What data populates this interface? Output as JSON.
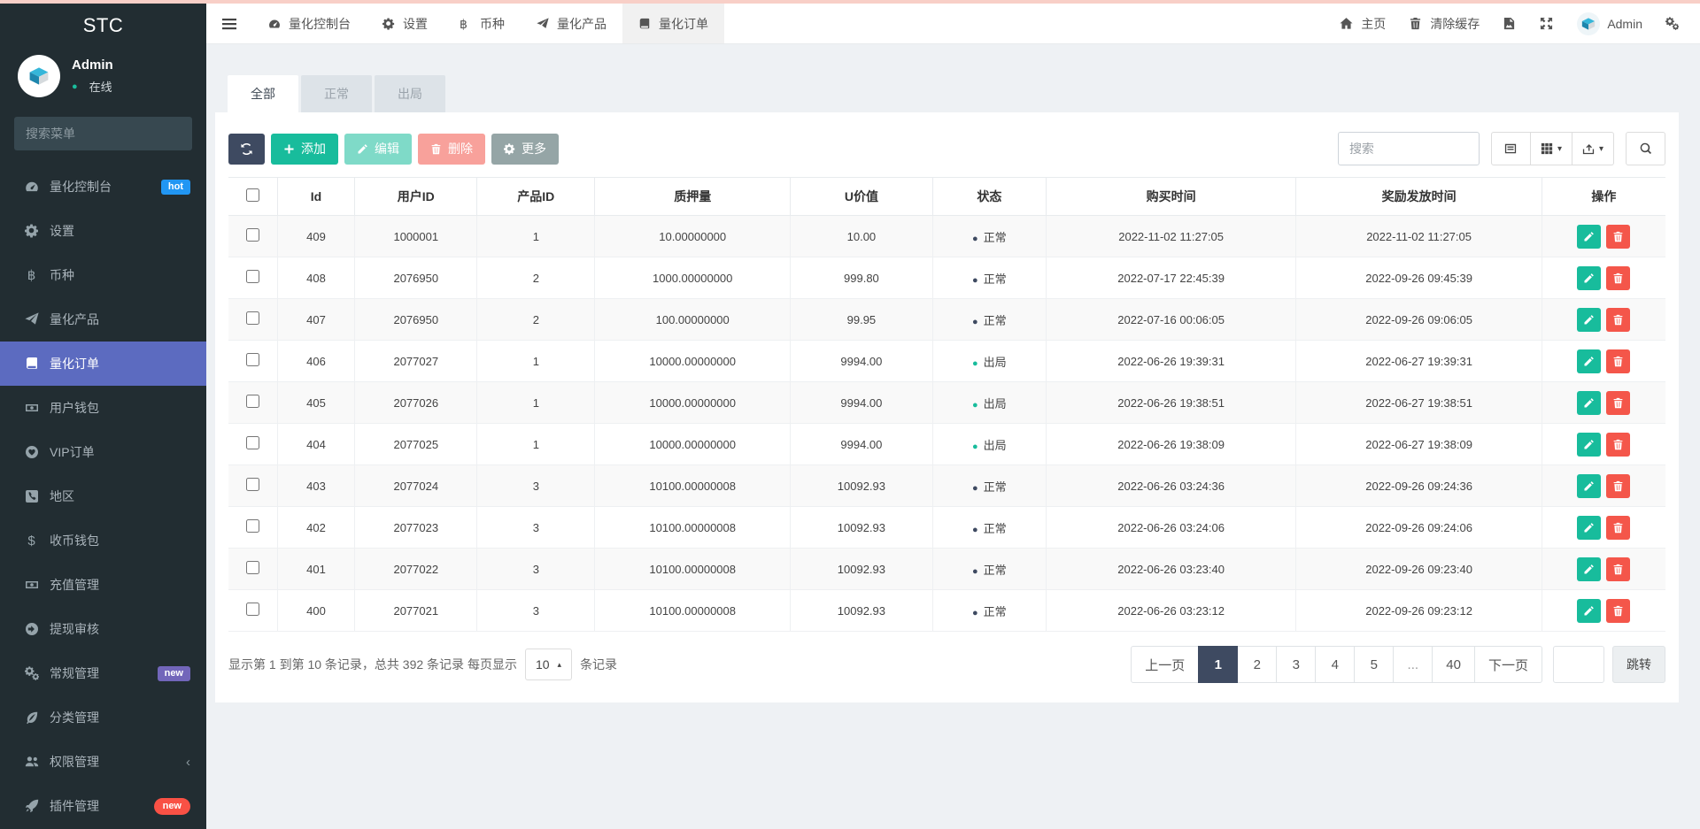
{
  "app": {
    "brand": "STC"
  },
  "colors": {
    "topstrip": "#f8cfc7",
    "sidebar_bg": "#222d32",
    "sidebar_active": "#5c6bc0",
    "success": "#18bc9c",
    "danger": "#f4564a",
    "dark": "#3e4a61",
    "hot_badge": "#2196f3",
    "new_badge_purple": "#7266ba",
    "new_badge_red": "#f95145"
  },
  "sidebar": {
    "user": {
      "name": "Admin",
      "status": "在线"
    },
    "search_placeholder": "搜索菜单",
    "items": [
      {
        "key": "dashboard",
        "label": "量化控制台",
        "icon": "gauge-icon",
        "badge": "hot",
        "badge_color": "#2196f3"
      },
      {
        "key": "settings",
        "label": "设置",
        "icon": "gear-icon"
      },
      {
        "key": "currency",
        "label": "币种",
        "icon": "bitcoin-icon"
      },
      {
        "key": "product",
        "label": "量化产品",
        "icon": "send-icon"
      },
      {
        "key": "order",
        "label": "量化订单",
        "icon": "book-icon",
        "active": true
      },
      {
        "key": "user-wallet",
        "label": "用户钱包",
        "icon": "money-icon"
      },
      {
        "key": "vip-order",
        "label": "VIP订单",
        "icon": "heart-icon"
      },
      {
        "key": "region",
        "label": "地区",
        "icon": "phone-icon"
      },
      {
        "key": "coin-wallet",
        "label": "收币钱包",
        "icon": "dollar-icon"
      },
      {
        "key": "recharge",
        "label": "充值管理",
        "icon": "money-icon"
      },
      {
        "key": "withdraw",
        "label": "提现审核",
        "icon": "arrow-circle-icon"
      },
      {
        "key": "general",
        "label": "常规管理",
        "icon": "cogs-icon",
        "badge": "new",
        "badge_color": "#7266ba"
      },
      {
        "key": "category",
        "label": "分类管理",
        "icon": "leaf-icon"
      },
      {
        "key": "auth",
        "label": "权限管理",
        "icon": "users-icon",
        "chevron": "‹"
      },
      {
        "key": "addon",
        "label": "插件管理",
        "icon": "rocket-icon",
        "badge": "new",
        "badge_color": "#f95145",
        "badge_pill": true
      }
    ]
  },
  "topbar": {
    "tabs": [
      {
        "key": "dashboard",
        "label": "量化控制台",
        "icon": "gauge-icon"
      },
      {
        "key": "settings",
        "label": "设置",
        "icon": "gear-icon"
      },
      {
        "key": "currency",
        "label": "币种",
        "icon": "bitcoin-icon"
      },
      {
        "key": "product",
        "label": "量化产品",
        "icon": "send-icon"
      },
      {
        "key": "order",
        "label": "量化订单",
        "icon": "book-icon",
        "active": true
      }
    ],
    "right": {
      "home": "主页",
      "clear_cache": "清除缓存",
      "username": "Admin"
    }
  },
  "content": {
    "tabs": [
      {
        "label": "全部",
        "active": true
      },
      {
        "label": "正常"
      },
      {
        "label": "出局"
      }
    ],
    "toolbar": {
      "add": "添加",
      "edit": "编辑",
      "delete": "删除",
      "more": "更多",
      "search_placeholder": "搜索"
    },
    "table": {
      "columns": [
        "Id",
        "用户ID",
        "产品ID",
        "质押量",
        "U价值",
        "状态",
        "购买时间",
        "奖励发放时间",
        "操作"
      ],
      "rows": [
        {
          "id": "409",
          "user_id": "1000001",
          "product_id": "1",
          "pledge": "10.00000000",
          "u_value": "10.00",
          "status": "正常",
          "status_type": "normal",
          "buy_time": "2022-11-02 11:27:05",
          "reward_time": "2022-11-02 11:27:05"
        },
        {
          "id": "408",
          "user_id": "2076950",
          "product_id": "2",
          "pledge": "1000.00000000",
          "u_value": "999.80",
          "status": "正常",
          "status_type": "normal",
          "buy_time": "2022-07-17 22:45:39",
          "reward_time": "2022-09-26 09:45:39"
        },
        {
          "id": "407",
          "user_id": "2076950",
          "product_id": "2",
          "pledge": "100.00000000",
          "u_value": "99.95",
          "status": "正常",
          "status_type": "normal",
          "buy_time": "2022-07-16 00:06:05",
          "reward_time": "2022-09-26 09:06:05"
        },
        {
          "id": "406",
          "user_id": "2077027",
          "product_id": "1",
          "pledge": "10000.00000000",
          "u_value": "9994.00",
          "status": "出局",
          "status_type": "out",
          "buy_time": "2022-06-26 19:39:31",
          "reward_time": "2022-06-27 19:39:31"
        },
        {
          "id": "405",
          "user_id": "2077026",
          "product_id": "1",
          "pledge": "10000.00000000",
          "u_value": "9994.00",
          "status": "出局",
          "status_type": "out",
          "buy_time": "2022-06-26 19:38:51",
          "reward_time": "2022-06-27 19:38:51"
        },
        {
          "id": "404",
          "user_id": "2077025",
          "product_id": "1",
          "pledge": "10000.00000000",
          "u_value": "9994.00",
          "status": "出局",
          "status_type": "out",
          "buy_time": "2022-06-26 19:38:09",
          "reward_time": "2022-06-27 19:38:09"
        },
        {
          "id": "403",
          "user_id": "2077024",
          "product_id": "3",
          "pledge": "10100.00000008",
          "u_value": "10092.93",
          "status": "正常",
          "status_type": "normal",
          "buy_time": "2022-06-26 03:24:36",
          "reward_time": "2022-09-26 09:24:36"
        },
        {
          "id": "402",
          "user_id": "2077023",
          "product_id": "3",
          "pledge": "10100.00000008",
          "u_value": "10092.93",
          "status": "正常",
          "status_type": "normal",
          "buy_time": "2022-06-26 03:24:06",
          "reward_time": "2022-09-26 09:24:06"
        },
        {
          "id": "401",
          "user_id": "2077022",
          "product_id": "3",
          "pledge": "10100.00000008",
          "u_value": "10092.93",
          "status": "正常",
          "status_type": "normal",
          "buy_time": "2022-06-26 03:23:40",
          "reward_time": "2022-09-26 09:23:40"
        },
        {
          "id": "400",
          "user_id": "2077021",
          "product_id": "3",
          "pledge": "10100.00000008",
          "u_value": "10092.93",
          "status": "正常",
          "status_type": "normal",
          "buy_time": "2022-06-26 03:23:12",
          "reward_time": "2022-09-26 09:23:12"
        }
      ]
    },
    "footer": {
      "summary_prefix": "显示第 1 到第 10 条记录，总共 392 条记录 每页显示",
      "page_size": "10",
      "summary_suffix": "条记录",
      "pagination": [
        "上一页",
        "1",
        "2",
        "3",
        "4",
        "5",
        "...",
        "40",
        "下一页"
      ],
      "active_page": "1",
      "jump_label": "跳转"
    }
  }
}
